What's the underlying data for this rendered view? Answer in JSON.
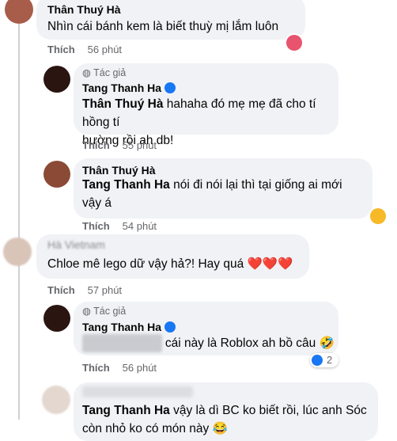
{
  "comments": [
    {
      "name": "Thân Thuý Hà",
      "text": "Nhìn cái bánh kem là biết thuỳ mị lắm luôn",
      "like_label": "Thích",
      "time": "56 phút",
      "reaction": "heart-eyes"
    },
    {
      "author_tag": "Tác giả",
      "name": "Tang Thanh Ha",
      "mention": "Thân Thuý Hà",
      "text_line1": " hahaha đó mẹ mẹ đã cho tí hồng tí",
      "text_line2": "hường rồi ah db!",
      "like_label": "Thích",
      "time": "55 phút"
    },
    {
      "name": "Thân Thuý Hà",
      "mention": "Tang Thanh Ha",
      "text_line1": " nói đi nói lại thì tại giống ai mới",
      "text_line2": "vậy á",
      "like_label": "Thích",
      "time": "54 phút",
      "reaction": "haha"
    },
    {
      "name_partial": "Hà Vietnam",
      "text": "Chloe mê lego dữ vậy hả?! Hay quá ❤️❤️❤️",
      "like_label": "Thích",
      "time": "57 phút"
    },
    {
      "author_tag": "Tác giả",
      "name": "Tang Thanh Ha",
      "text": " cái này là Roblox ah bồ câu 🤣",
      "like_label": "Thích",
      "time": "56 phút",
      "reaction_count": "2"
    },
    {
      "mention": "Tang Thanh Ha",
      "text_line1": " vậy là dì BC ko biết rồi, lúc anh Sóc",
      "text_line2": "còn nhỏ ko có món này 😂"
    }
  ]
}
